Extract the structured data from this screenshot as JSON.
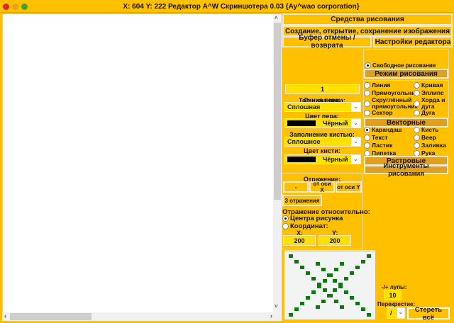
{
  "title": "X: 604 Y: 222  Редактор A^W Скриншотера 0.03 {Ay^wao corporation}",
  "colors": {
    "accent": "#FFC000",
    "header": "#DFA020",
    "input": "#FFE000",
    "pixel": "#0A7A0A"
  },
  "tabs": {
    "drawing": "Средства рисования",
    "file": "Создание, открытие, сохранение изображения",
    "undo": "Буфер отмены / возврата",
    "settings": "Настройки редактора"
  },
  "pen": {
    "width_label": "Толщина пера:",
    "width": "1",
    "line_label": "Линия пера:",
    "line": "Сплошная",
    "color_label": "Цвет пера:",
    "color": "Чёрный",
    "fill_label": "Заполнение кистью:",
    "fill": "Сплошное",
    "brush_color_label": "Цвет кисти:",
    "brush_color": "Чёрный"
  },
  "modes": {
    "free": "Свободное рисование",
    "header": "Режим рисования",
    "vector_header": "Векторные",
    "raster_header": "Растровые",
    "tools_header": "Инструменты рисования",
    "vector": [
      "Линия",
      "Кривая",
      "Прямоугольник",
      "Эллипс",
      "Скруглённый прямоугольник",
      "Хорда и дуга",
      "Сектор",
      "Дуга"
    ],
    "raster": [
      "Карандаш",
      "Кисть",
      "Текст",
      "Веер",
      "Ластик",
      "Заливка",
      "Пипетка",
      "Рука"
    ]
  },
  "reflect": {
    "label": "Отражение:",
    "none": "-",
    "x_axis": "от оси X",
    "y_axis": "от оси Y",
    "three": "3 отражения",
    "relative": "Отражение относительно:",
    "center": "Центра рисунка",
    "coords": "Координат:",
    "x_label": "X:",
    "y_label": "Y:",
    "x": "200",
    "y": "200"
  },
  "zoom": {
    "label": "-/+ лупы:",
    "value": "10",
    "cross_label": "Перекрестие:",
    "cross": "/",
    "clear": "Стереть всё"
  }
}
